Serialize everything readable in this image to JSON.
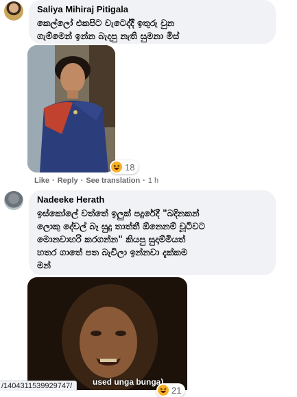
{
  "comments": [
    {
      "author": "Saliya Mihiraj Pitigala",
      "text": "කෙල්ලෝ එකපිට වැටෙද්දී ඉතුරු වුන\nගැම්මෙන් ඉන්න බැදපු නැති සුමනා මිස්",
      "reaction_count": "18"
    },
    {
      "author": "Nadeeke Herath",
      "text": "ඉස්කෝලේ වත්තේ ඉලුක් පදුරේදී \"බදිනකන්\nලොකු දේවල් බෑ සුදු තාත්තී ඕනෙනම් චූටිවට\nමොනවාහරි කරගන්න\" කියපු සුදාම්මියත්\nහතර ගාතේ පත බැවිලා ඉන්නවා දැක්කම\nමන්",
      "reaction_count": "21",
      "image_caption": "used unga bunga)"
    }
  ],
  "actions": {
    "like": "Like",
    "reply": "Reply",
    "translate": "See translation",
    "time": "1 h",
    "separator": "·"
  },
  "status_url": "/1404311539929747/",
  "icons": {
    "reaction": "haha-icon"
  },
  "colors": {
    "bubble": "#f0f2f5",
    "meta": "#65676b",
    "haha": "#f7b125"
  }
}
